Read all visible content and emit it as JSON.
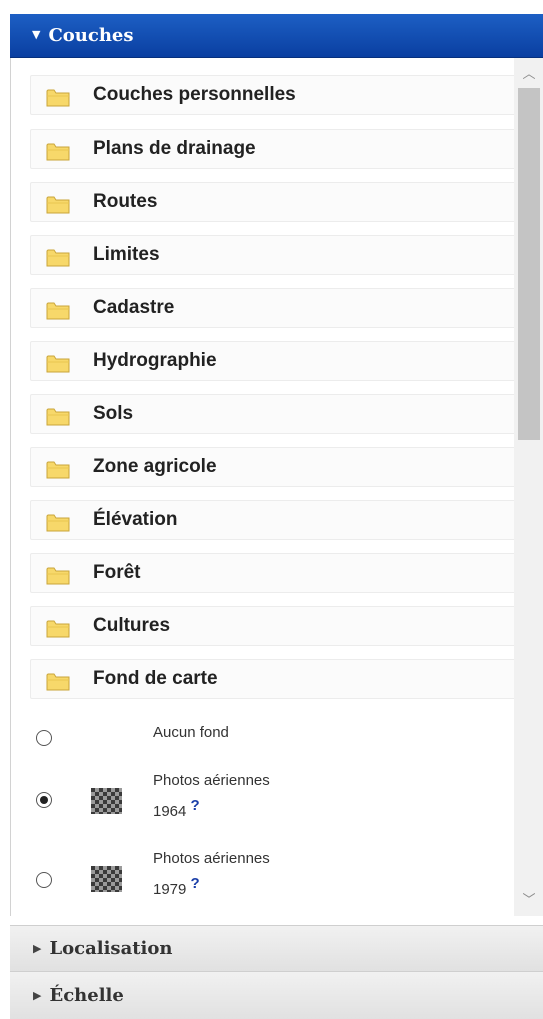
{
  "panels": {
    "layers": {
      "title": "Couches",
      "expanded": true
    },
    "location": {
      "title": "Localisation",
      "expanded": false
    },
    "scale": {
      "title": "Échelle",
      "expanded": false
    }
  },
  "layer_groups": [
    {
      "label": "Couches personnelles"
    },
    {
      "label": "Plans de drainage"
    },
    {
      "label": "Routes"
    },
    {
      "label": "Limites"
    },
    {
      "label": "Cadastre"
    },
    {
      "label": "Hydrographie"
    },
    {
      "label": "Sols"
    },
    {
      "label": "Zone agricole"
    },
    {
      "label": "Élévation"
    },
    {
      "label": "Forêt"
    },
    {
      "label": "Cultures"
    },
    {
      "label": "Fond de carte"
    }
  ],
  "basemaps": [
    {
      "line1": "Aucun fond",
      "line2": "",
      "help": "",
      "selected": false,
      "thumbnail": false
    },
    {
      "line1": "Photos aériennes",
      "line2": "1964",
      "help": "?",
      "selected": true,
      "thumbnail": true
    },
    {
      "line1": "Photos aériennes",
      "line2": "1979",
      "help": "?",
      "selected": false,
      "thumbnail": true
    }
  ],
  "icons": {
    "expanded": "triangle-down-icon",
    "collapsed": "triangle-right-icon",
    "folder": "folder-icon",
    "help": "help-icon"
  },
  "colors": {
    "header_blue": "#0a3fa1",
    "folder_yellow": "#f7d86a",
    "help_blue": "#1a3ea8"
  }
}
